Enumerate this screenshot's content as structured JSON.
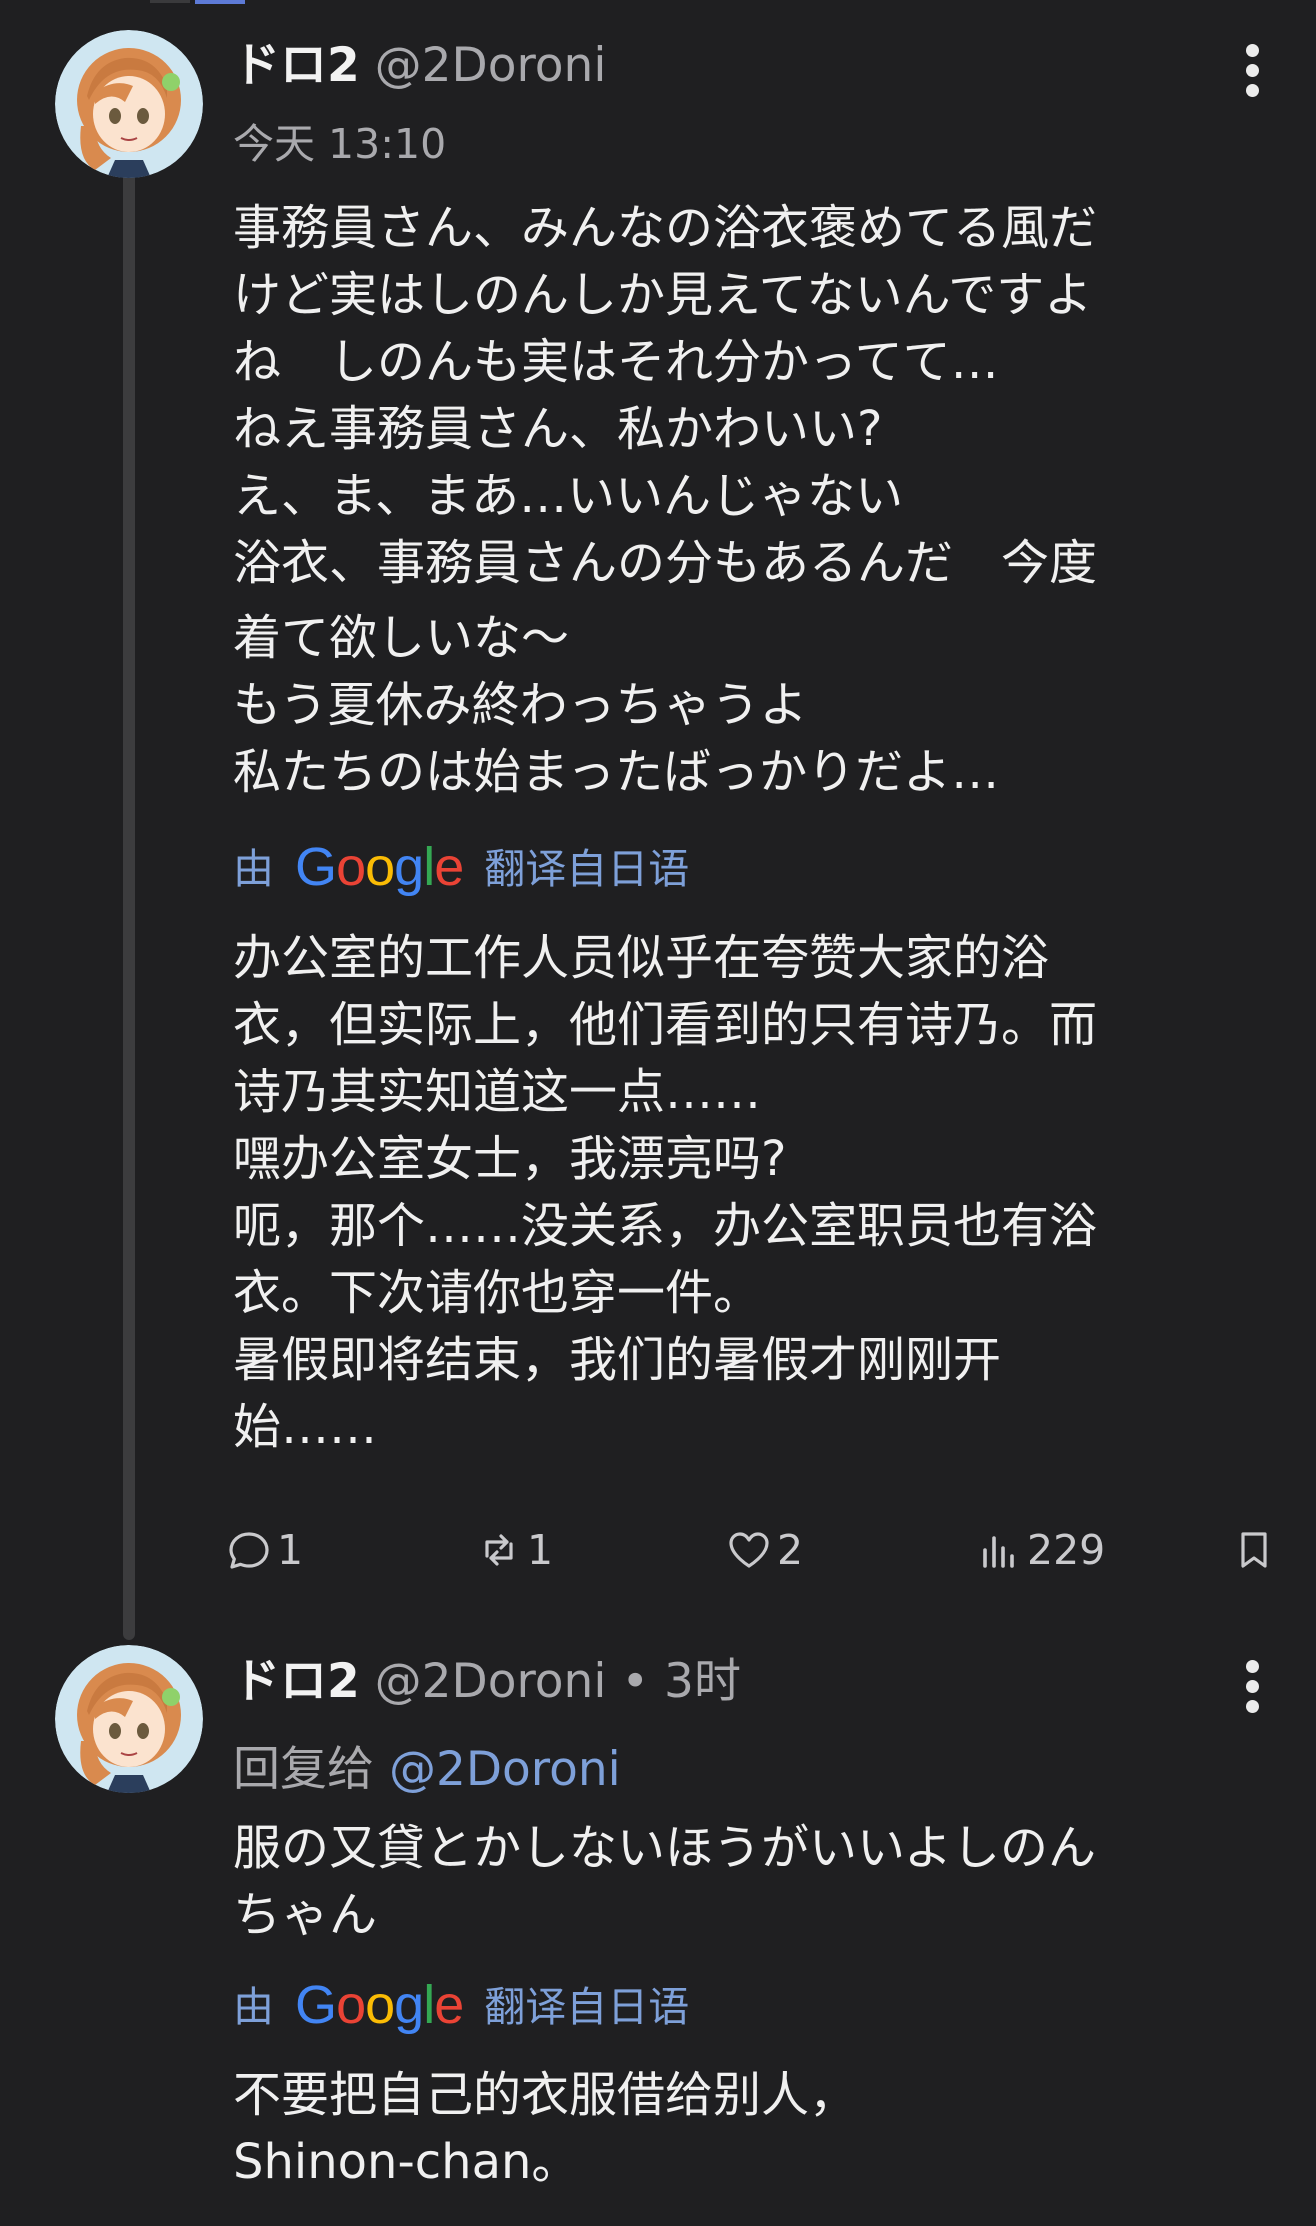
{
  "colors": {
    "background": "#1f1f21",
    "text": "#f0f0f0",
    "muted": "#a9a9ad",
    "link": "#7ea0d9"
  },
  "tweet1": {
    "name": "ドロ2",
    "handle": "@2Doroni",
    "time": "今天 13:10",
    "original_lines": [
      "事務員さん、みんなの浴衣褒めてる風だ",
      "けど実はしのんしか見えてないんですよ",
      "ね　しのんも実はそれ分かってて…",
      "ねえ事務員さん、私かわいい?",
      "え、ま、まあ…いいんじゃない",
      "浴衣、事務員さんの分もあるんだ　今度",
      "着て欲しいな〜",
      "もう夏休み終わっちゃうよ",
      "私たちのは始まったばっかりだよ…"
    ],
    "translate_by": "由",
    "translate_brand": "Google",
    "translate_from": "翻译自日语",
    "translated_lines": [
      "办公室的工作人员似乎在夸赞大家的浴",
      "衣，但实际上，他们看到的只有诗乃。而",
      "诗乃其实知道这一点……",
      "嘿办公室女士，我漂亮吗?",
      "呃，那个……没关系，办公室职员也有浴",
      "衣。下次请你也穿一件。",
      "暑假即将结束，我们的暑假才刚刚开",
      "始……"
    ],
    "actions": {
      "replies": "1",
      "retweets": "1",
      "likes": "2",
      "views": "229"
    },
    "icons": [
      "reply-icon",
      "retweet-icon",
      "like-icon",
      "views-icon",
      "bookmark-icon",
      "more-icon"
    ]
  },
  "tweet2": {
    "name": "ドロ2",
    "handle": "@2Doroni",
    "separator": "•",
    "time": "3时",
    "reply_prefix": "回复给",
    "reply_handle": "@2Doroni",
    "original_lines": [
      "服の又貸とかしないほうがいいよしのん",
      "ちゃん"
    ],
    "translate_by": "由",
    "translate_brand": "Google",
    "translate_from": "翻译自日语",
    "translated_lines": [
      "不要把自己的衣服借给别人，",
      "Shinon-chan。"
    ]
  }
}
